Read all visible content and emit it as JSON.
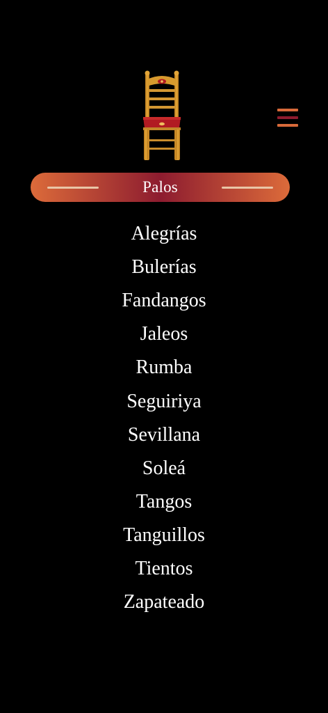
{
  "header": {
    "title": "Palos"
  },
  "logo": {
    "icon": "flamenco-chair-icon"
  },
  "menu": {
    "icon": "hamburger-menu-icon"
  },
  "palos": [
    "Alegrías",
    "Bulerías",
    "Fandangos",
    "Jaleos",
    "Rumba",
    "Seguiriya",
    "Sevillana",
    "Soleá",
    "Tangos",
    "Tanguillos",
    "Tientos",
    "Zapateado"
  ],
  "colors": {
    "background": "#000000",
    "accent_orange": "#d86a3a",
    "accent_red": "#8e1b2e",
    "header_gradient_start": "#dc6b3a",
    "header_gradient_mid": "#8d1c2f",
    "header_gradient_end": "#dc6b3a",
    "header_lines": "#e9c6a7",
    "chair_wood": "#d99a2b",
    "chair_seat": "#b11a22",
    "text": "#ffffff"
  }
}
